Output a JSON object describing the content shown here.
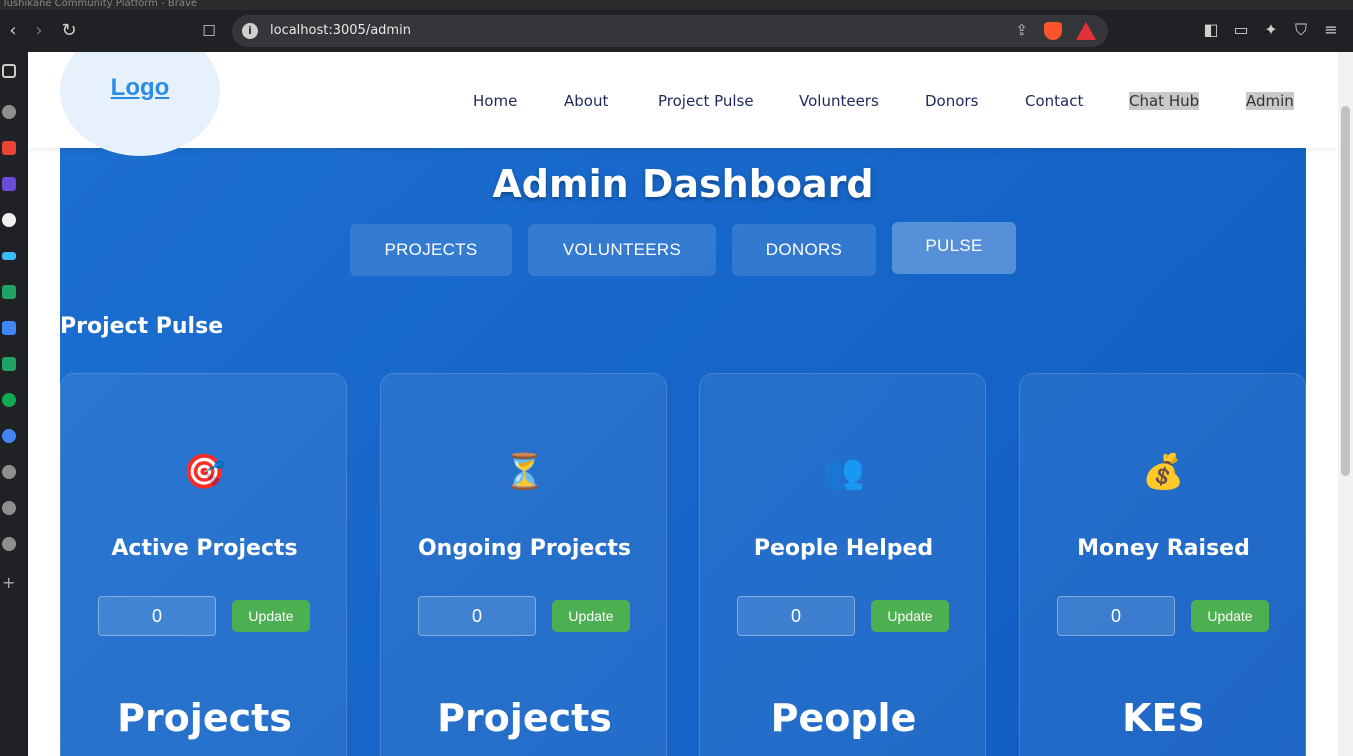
{
  "browser": {
    "window_title": "Tushikane Community Platform - Brave",
    "url": "localhost:3005/admin"
  },
  "header": {
    "logo": "Logo",
    "nav": [
      "Home",
      "About",
      "Project Pulse",
      "Volunteers",
      "Donors",
      "Contact",
      "Chat Hub",
      "Admin"
    ]
  },
  "dashboard": {
    "title": "Admin Dashboard",
    "tabs": [
      "PROJECTS",
      "VOLUNTEERS",
      "DONORS",
      "PULSE"
    ],
    "active_tab": "PULSE",
    "section_title": "Project Pulse",
    "cards": [
      {
        "icon": "🎯",
        "icon_name": "target-icon",
        "title": "Active Projects",
        "value": "0",
        "button": "Update",
        "big_label": "Projects"
      },
      {
        "icon": "⏳",
        "icon_name": "hourglass-icon",
        "title": "Ongoing Projects",
        "value": "0",
        "button": "Update",
        "big_label": "Projects"
      },
      {
        "icon": "👥",
        "icon_name": "people-icon",
        "title": "People Helped",
        "value": "0",
        "button": "Update",
        "big_label": "People"
      },
      {
        "icon": "💰",
        "icon_name": "money-bag-icon",
        "title": "Money Raised",
        "value": "0",
        "button": "Update",
        "big_label": "KES"
      }
    ]
  },
  "colors": {
    "dashboard_bg": "#1565c8",
    "update_button": "#4caf50",
    "logo": "#2b8ce8",
    "nav_text": "#1c2a5a"
  }
}
